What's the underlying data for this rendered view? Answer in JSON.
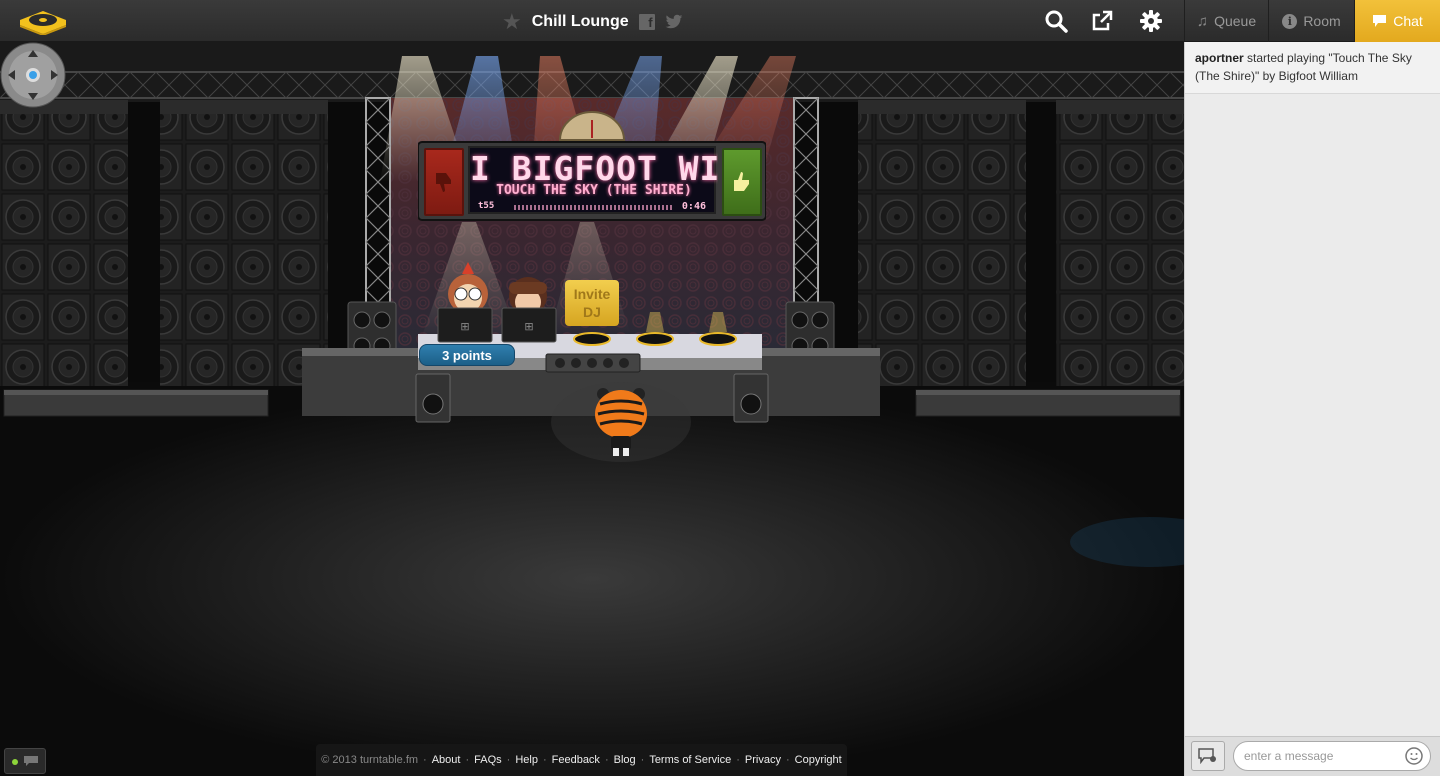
{
  "header": {
    "room_title": "Chill Lounge",
    "facebook_label": "f",
    "icons": [
      "turntable-logo-icon",
      "star-icon",
      "facebook-icon",
      "twitter-icon",
      "search-icon",
      "share-icon",
      "gear-icon"
    ]
  },
  "tabs": [
    {
      "label": "Queue",
      "icon": "music-note-icon",
      "active": false
    },
    {
      "label": "Room",
      "icon": "info-icon",
      "active": false
    },
    {
      "label": "Chat",
      "icon": "chat-bubble-icon",
      "active": true
    }
  ],
  "now_playing": {
    "artist": "I BIGFOOT WILL",
    "song": "TOUCH THE SKY (THE SHIRE)",
    "elapsed": "t55",
    "remaining": "0:46"
  },
  "stage": {
    "invite_dj": "Invite DJ",
    "dj_points": "3 points"
  },
  "footer": {
    "copyright": "© 2013 turntable.fm",
    "links": [
      "About",
      "FAQs",
      "Help",
      "Feedback",
      "Blog",
      "Terms of Service",
      "Privacy",
      "Copyright"
    ]
  },
  "chat": {
    "messages": [
      {
        "user": "aportner",
        "text": " started playing \"Touch The Sky (The Shire)\" by Bigfoot William"
      }
    ],
    "input_placeholder": "enter a message"
  },
  "colors": {
    "accent": "#e8b02a",
    "topbar": "#2f2f2f",
    "points_badge": "#2a7aab",
    "lame": "#9a2419",
    "awesome": "#4e8a26"
  }
}
